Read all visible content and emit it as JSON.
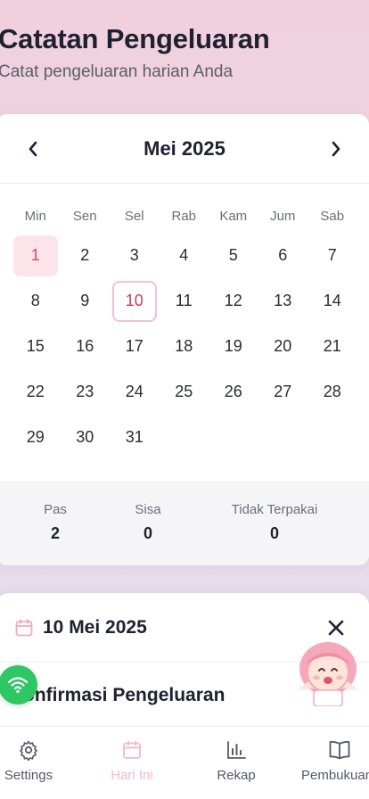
{
  "header": {
    "title": "Catatan Pengeluaran",
    "subtitle": "Catat pengeluaran harian Anda"
  },
  "calendar": {
    "month_label": "Mei 2025",
    "weekdays": [
      "Min",
      "Sen",
      "Sel",
      "Rab",
      "Kam",
      "Jum",
      "Sab"
    ],
    "days": [
      "1",
      "2",
      "3",
      "4",
      "5",
      "6",
      "7",
      "8",
      "9",
      "10",
      "11",
      "12",
      "13",
      "14",
      "15",
      "16",
      "17",
      "18",
      "19",
      "20",
      "21",
      "22",
      "23",
      "24",
      "25",
      "26",
      "27",
      "28",
      "29",
      "30",
      "31"
    ],
    "selected_day": "1",
    "today_day": "10",
    "stats": [
      {
        "label": "Pas",
        "value": "2"
      },
      {
        "label": "Sisa",
        "value": "0"
      },
      {
        "label": "Tidak Terpakai",
        "value": "0"
      }
    ]
  },
  "day_detail": {
    "date": "10 Mei 2025",
    "section_title": "onfirmasi Pengeluaran"
  },
  "nav": {
    "items": [
      {
        "label": "Settings",
        "icon": "gear-icon"
      },
      {
        "label": "Hari Ini",
        "icon": "calendar-icon"
      },
      {
        "label": "Rekap",
        "icon": "bar-chart-icon"
      },
      {
        "label": "Pembukuan",
        "icon": "book-icon"
      }
    ]
  },
  "colors": {
    "accent": "#d14b6d",
    "selected_bg": "#fde3ea",
    "wifi_green": "#2ec766"
  }
}
